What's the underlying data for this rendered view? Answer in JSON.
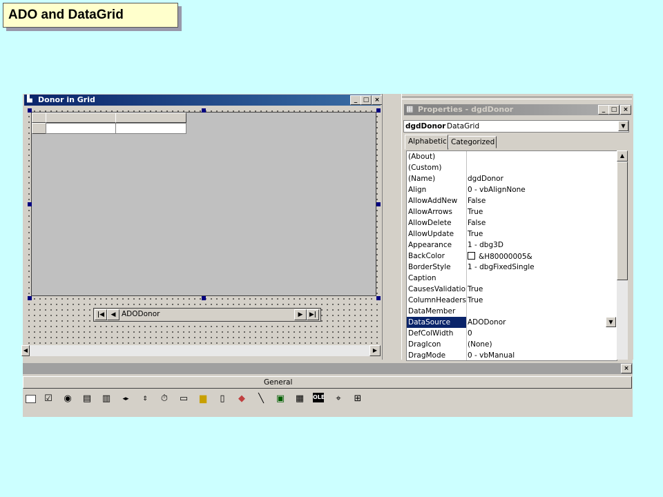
{
  "slide": {
    "title": "ADO and DataGrid"
  },
  "form": {
    "title": "Donor in Grid",
    "adodc_caption": "ADODonor",
    "nav": {
      "first": "|◀",
      "prev": "◀",
      "next": "▶",
      "last": "▶|"
    }
  },
  "window_buttons": {
    "minimize": "_",
    "maximize": "□",
    "close": "×"
  },
  "properties": {
    "title": "Properties - dgdDonor",
    "object_name": "dgdDonor",
    "object_type": "DataGrid",
    "tabs": [
      "Alphabetic",
      "Categorized"
    ],
    "rows": [
      {
        "name": "(About)",
        "value": ""
      },
      {
        "name": "(Custom)",
        "value": ""
      },
      {
        "name": "(Name)",
        "value": "dgdDonor"
      },
      {
        "name": "Align",
        "value": "0 - vbAlignNone"
      },
      {
        "name": "AllowAddNew",
        "value": "False"
      },
      {
        "name": "AllowArrows",
        "value": "True"
      },
      {
        "name": "AllowDelete",
        "value": "False"
      },
      {
        "name": "AllowUpdate",
        "value": "True"
      },
      {
        "name": "Appearance",
        "value": "1 - dbg3D"
      },
      {
        "name": "BackColor",
        "value": "&H80000005&"
      },
      {
        "name": "BorderStyle",
        "value": "1 - dbgFixedSingle"
      },
      {
        "name": "Caption",
        "value": ""
      },
      {
        "name": "CausesValidation",
        "value": "True"
      },
      {
        "name": "ColumnHeaders",
        "value": "True"
      },
      {
        "name": "DataMember",
        "value": ""
      },
      {
        "name": "DataSource",
        "value": "ADODonor"
      },
      {
        "name": "DefColWidth",
        "value": "0"
      },
      {
        "name": "DragIcon",
        "value": "(None)"
      },
      {
        "name": "DragMode",
        "value": "0 - vbManual"
      }
    ],
    "selected_row": "DataSource"
  },
  "toolbox": {
    "section_label": "General",
    "tools": [
      "textbox-tool",
      "checkbox-tool",
      "option-tool",
      "combobox-tool",
      "listbox-tool",
      "hscroll-tool",
      "vscroll-tool",
      "timer-tool",
      "drive-tool",
      "dir-tool",
      "file-tool",
      "shape-tool",
      "line-tool",
      "image-tool",
      "data-tool",
      "ole-tool",
      "adodc-tool",
      "datagrid-tool"
    ]
  },
  "colors": {
    "desktop": "#ccffff",
    "title_start": "#0a246a",
    "title_end": "#3a6ea5",
    "selection": "#0a246a",
    "face": "#d4d0c8"
  }
}
